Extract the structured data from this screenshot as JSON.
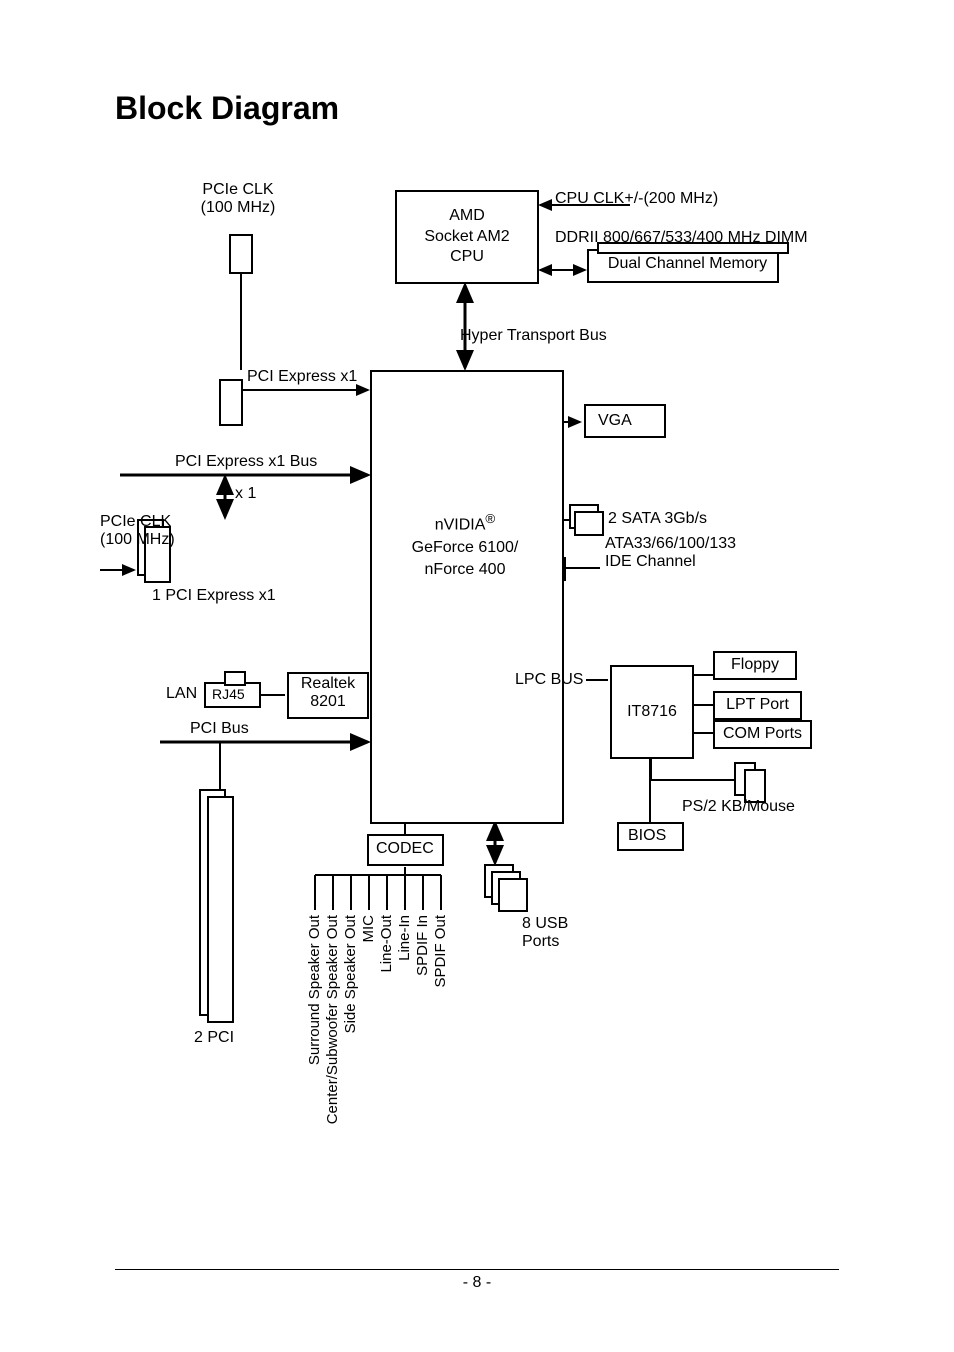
{
  "title": "Block Diagram",
  "cpu": {
    "l1": "AMD",
    "l2": "Socket AM2",
    "l3": "CPU"
  },
  "pcie_clk": {
    "l1": "PCIe CLK",
    "l2": "(100 MHz)"
  },
  "cpu_clk": "CPU CLK+/-(200 MHz)",
  "ddr": "DDRII 800/667/533/400 MHz DIMM",
  "dual_mem": "Dual Channel Memory",
  "ht_bus": "Hyper Transport Bus",
  "pcie_x1_top": "PCI Express x1",
  "vga": "VGA",
  "sata": "2 SATA 3Gb/s",
  "pcie_x1_bus": "PCI Express x1 Bus",
  "x1_label": "x 1",
  "pcie_clk2": {
    "l1": "PCIe CLK",
    "l2": "(100 MHz)"
  },
  "pcie_x1_bottom": "1 PCI Express x1",
  "chipset": {
    "brand": "nVIDIA",
    "reg": "®",
    "l2": "GeForce 6100/",
    "l3": "nForce 400"
  },
  "ide": {
    "l1": "ATA33/66/100/133",
    "l2": "IDE Channel"
  },
  "lpc": "LPC BUS",
  "floppy": "Floppy",
  "lpt": "LPT Port",
  "com": "COM Ports",
  "ps2": "PS/2 KB/Mouse",
  "it": "IT8716",
  "lan": "LAN",
  "rj45": "RJ45",
  "realtek": {
    "l1": "Realtek",
    "l2": "8201"
  },
  "pci_bus": "PCI Bus",
  "codec": "CODEC",
  "bios": "BIOS",
  "usb": {
    "l1": "8 USB",
    "l2": "Ports"
  },
  "pci_count": "2 PCI",
  "audio": {
    "surround": "Surround Speaker Out",
    "center": "Center/Subwoofer Speaker Out",
    "side": "Side Speaker Out",
    "mic": "MIC",
    "lineout": "Line-Out",
    "linein": "Line-In",
    "spdifin": "SPDIF In",
    "spdifout": "SPDIF Out"
  },
  "page_no": "- 8 -"
}
